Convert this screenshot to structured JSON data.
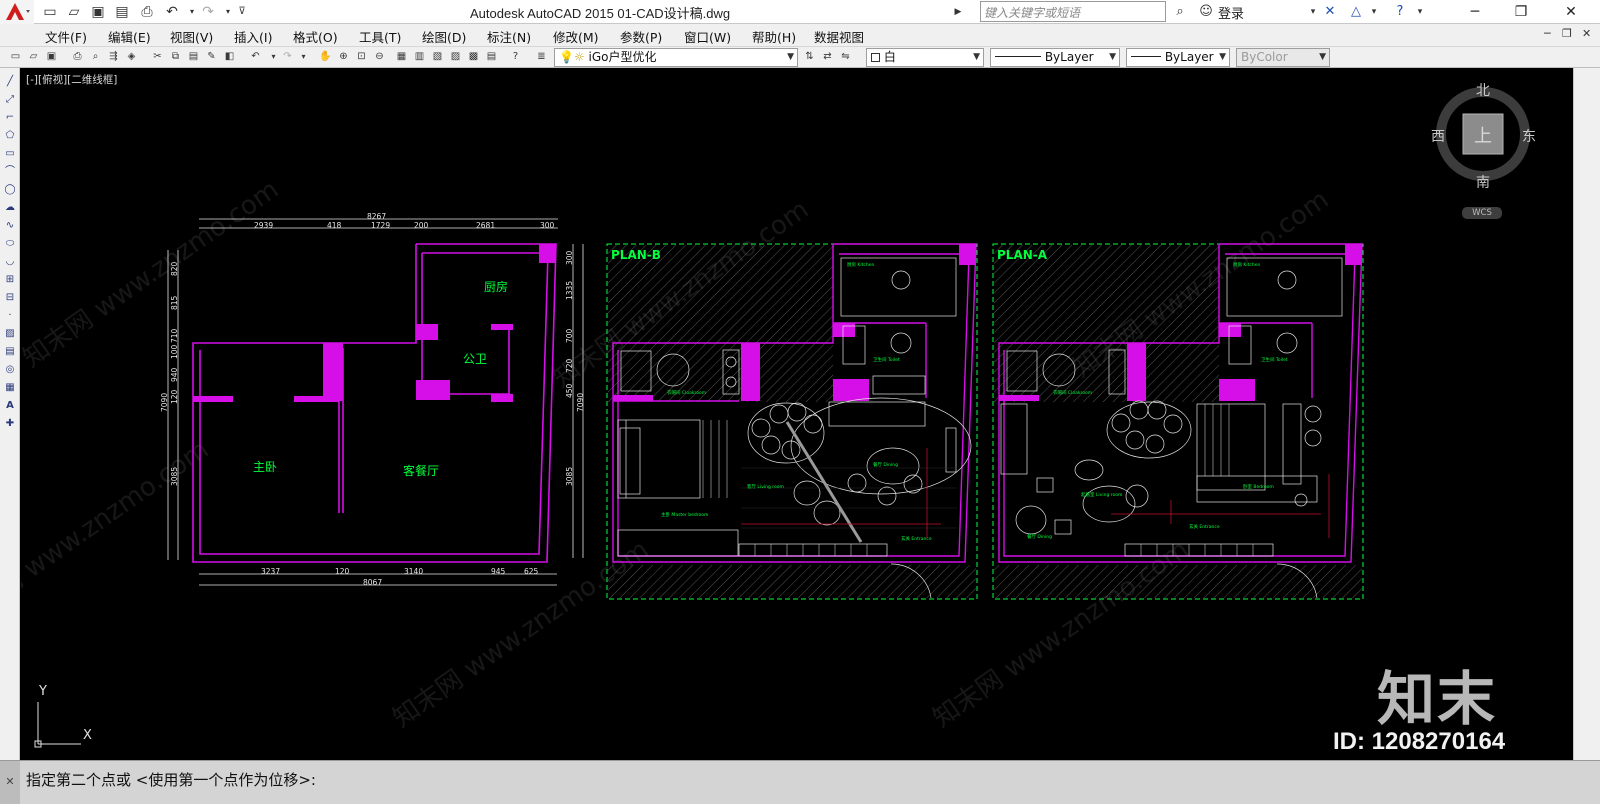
{
  "title_bar": {
    "title": "Autodesk AutoCAD 2015    01-CAD设计稿.dwg",
    "search_placeholder": "键入关键字或短语",
    "login_label": "登录"
  },
  "menu": {
    "items": [
      "文件(F)",
      "编辑(E)",
      "视图(V)",
      "插入(I)",
      "格式(O)",
      "工具(T)",
      "绘图(D)",
      "标注(N)",
      "修改(M)",
      "参数(P)",
      "窗口(W)",
      "帮助(H)",
      "数据视图"
    ]
  },
  "toolbar": {
    "layer_combo": "iGo户型优化",
    "color_combo": "白",
    "linetype_combo": "ByLayer",
    "lineweight_combo": "ByLayer",
    "plotstyle_combo": "ByColor"
  },
  "viewport": {
    "label": "[-][俯视][二维线框]"
  },
  "viewcube": {
    "north": "北",
    "south": "南",
    "west": "西",
    "east": "东",
    "face": "上",
    "wcs": "WCS"
  },
  "ucs": {
    "x": "X",
    "y": "Y"
  },
  "drawing": {
    "rooms": {
      "kitchen": "厨房",
      "bathroom": "公卫",
      "master_bedroom": "主卧",
      "living_dining": "客餐厅"
    },
    "dims_top": {
      "total": "8267",
      "segments": [
        "2939",
        "418",
        "1729",
        "200",
        "2681",
        "300"
      ]
    },
    "dims_bottom": {
      "total": "8067",
      "segments": [
        "3237",
        "120",
        "3140",
        "945",
        "625"
      ]
    },
    "dims_left": {
      "total": "7090",
      "segments": [
        "820",
        "815",
        "710",
        "100",
        "940",
        "120",
        "3085"
      ]
    },
    "dims_right": {
      "total": "7090",
      "segments": [
        "300",
        "1335",
        "700",
        "720",
        "450",
        "3085"
      ]
    },
    "plan_b_label": "PLAN-B",
    "plan_a_label": "PLAN-A"
  },
  "watermark": {
    "brand": "知末",
    "id": "ID: 1208270164",
    "diagonal_text": "知末网 www.znzmo.com"
  },
  "command_line": {
    "prompt": "指定第二个点或 <使用第一个点作为位移>:"
  },
  "colors": {
    "canvas_bg": "#000000",
    "wall_magenta": "#d60fe8",
    "annotation_green": "#00ff3c",
    "dim_white": "#e6e6e6"
  }
}
